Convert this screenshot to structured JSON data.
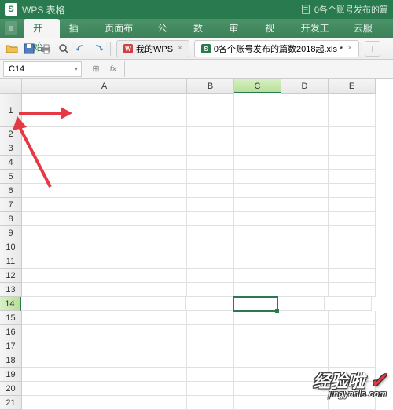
{
  "title": {
    "logo": "S",
    "text": "WPS 表格",
    "right_text": "0各个账号发布的篇"
  },
  "menu": {
    "items": [
      "开始",
      "插入",
      "页面布局",
      "公式",
      "数据",
      "审阅",
      "视图",
      "开发工具",
      "云服务"
    ],
    "active_index": 0
  },
  "toolbar": {
    "tabs": [
      {
        "label": "我的WPS",
        "close": "×",
        "wps_icon": "W"
      },
      {
        "label": "0各个账号发布的篇数2018起.xls *",
        "close": "×",
        "wps_icon": "S"
      }
    ],
    "plus": "+"
  },
  "formula": {
    "name_box": "C14",
    "fx": "fx"
  },
  "columns": [
    "A",
    "B",
    "C",
    "D",
    "E"
  ],
  "active_col_index": 2,
  "rows": [
    1,
    2,
    3,
    4,
    5,
    6,
    7,
    8,
    9,
    10,
    11,
    12,
    13,
    14,
    15,
    16,
    17,
    18,
    19,
    20,
    21
  ],
  "active_row": 14,
  "selected_cell": {
    "row": 14,
    "col": 2
  },
  "watermark": {
    "main": "经验啦",
    "sub": "jingyanla.com"
  }
}
